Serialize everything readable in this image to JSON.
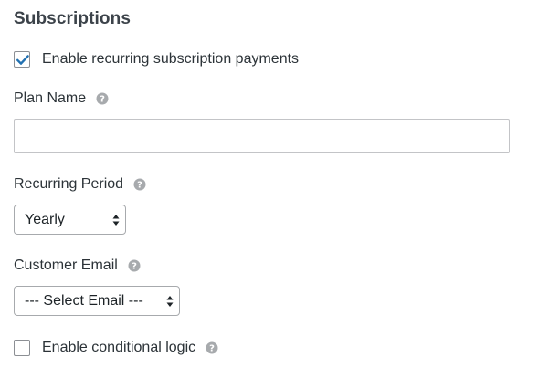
{
  "section": {
    "title": "Subscriptions"
  },
  "enable_recurring": {
    "label": "Enable recurring subscription payments",
    "checked": true
  },
  "plan_name": {
    "label": "Plan Name",
    "help_icon": "help-circle-icon",
    "value": "",
    "placeholder": ""
  },
  "recurring_period": {
    "label": "Recurring Period",
    "help_icon": "help-circle-icon",
    "selected": "Yearly"
  },
  "customer_email": {
    "label": "Customer Email",
    "help_icon": "help-circle-icon",
    "selected": "--- Select Email ---"
  },
  "conditional_logic": {
    "label": "Enable conditional logic",
    "help_icon": "help-circle-icon",
    "checked": false
  },
  "colors": {
    "checkmark": "#2271b1",
    "help_icon": "#a7aaad",
    "text": "#2c3338"
  }
}
